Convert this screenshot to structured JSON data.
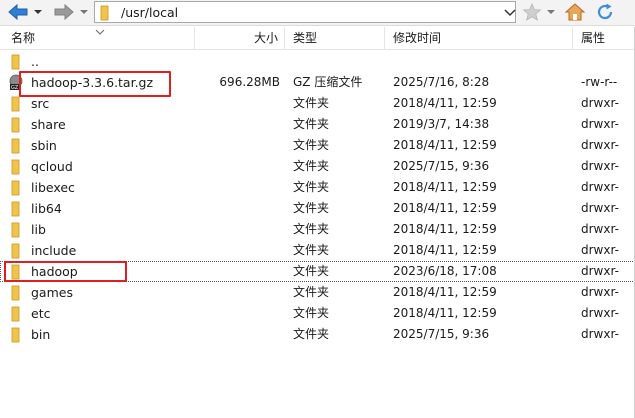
{
  "toolbar": {
    "path": "/usr/local",
    "icons": {
      "back": "back-arrow-icon",
      "forward": "forward-arrow-icon",
      "favorite": "star-icon",
      "home": "home-icon",
      "refresh": "refresh-icon"
    },
    "accent_color": "#2f7fd6"
  },
  "columns": {
    "name": "名称",
    "size": "大小",
    "type": "类型",
    "mtime": "修改时间",
    "perm": "属性"
  },
  "files": [
    {
      "name": "..",
      "size": "",
      "type": "",
      "mtime": "",
      "perm": "",
      "icon": "folder-icon"
    },
    {
      "name": "hadoop-3.3.6.tar.gz",
      "size": "696.28MB",
      "type": "GZ 压缩文件",
      "mtime": "2025/7/16, 8:28",
      "perm": "-rw-r--",
      "icon": "archive-icon"
    },
    {
      "name": "src",
      "size": "",
      "type": "文件夹",
      "mtime": "2018/4/11, 12:59",
      "perm": "drwxr-",
      "icon": "folder-icon"
    },
    {
      "name": "share",
      "size": "",
      "type": "文件夹",
      "mtime": "2019/3/7, 14:38",
      "perm": "drwxr-",
      "icon": "folder-icon"
    },
    {
      "name": "sbin",
      "size": "",
      "type": "文件夹",
      "mtime": "2018/4/11, 12:59",
      "perm": "drwxr-",
      "icon": "folder-icon"
    },
    {
      "name": "qcloud",
      "size": "",
      "type": "文件夹",
      "mtime": "2025/7/15, 9:36",
      "perm": "drwxr-",
      "icon": "folder-icon"
    },
    {
      "name": "libexec",
      "size": "",
      "type": "文件夹",
      "mtime": "2018/4/11, 12:59",
      "perm": "drwxr-",
      "icon": "folder-icon"
    },
    {
      "name": "lib64",
      "size": "",
      "type": "文件夹",
      "mtime": "2018/4/11, 12:59",
      "perm": "drwxr-",
      "icon": "folder-icon"
    },
    {
      "name": "lib",
      "size": "",
      "type": "文件夹",
      "mtime": "2018/4/11, 12:59",
      "perm": "drwxr-",
      "icon": "folder-icon"
    },
    {
      "name": "include",
      "size": "",
      "type": "文件夹",
      "mtime": "2018/4/11, 12:59",
      "perm": "drwxr-",
      "icon": "folder-icon"
    },
    {
      "name": "hadoop",
      "size": "",
      "type": "文件夹",
      "mtime": "2023/6/18, 17:08",
      "perm": "drwxr-",
      "icon": "folder-icon"
    },
    {
      "name": "games",
      "size": "",
      "type": "文件夹",
      "mtime": "2018/4/11, 12:59",
      "perm": "drwxr-",
      "icon": "folder-icon"
    },
    {
      "name": "etc",
      "size": "",
      "type": "文件夹",
      "mtime": "2018/4/11, 12:59",
      "perm": "drwxr-",
      "icon": "folder-icon"
    },
    {
      "name": "bin",
      "size": "",
      "type": "文件夹",
      "mtime": "2025/7/15, 9:36",
      "perm": "drwxr-",
      "icon": "folder-icon"
    }
  ],
  "highlight_color": "#e02020",
  "folder_color": "#f2c34b"
}
